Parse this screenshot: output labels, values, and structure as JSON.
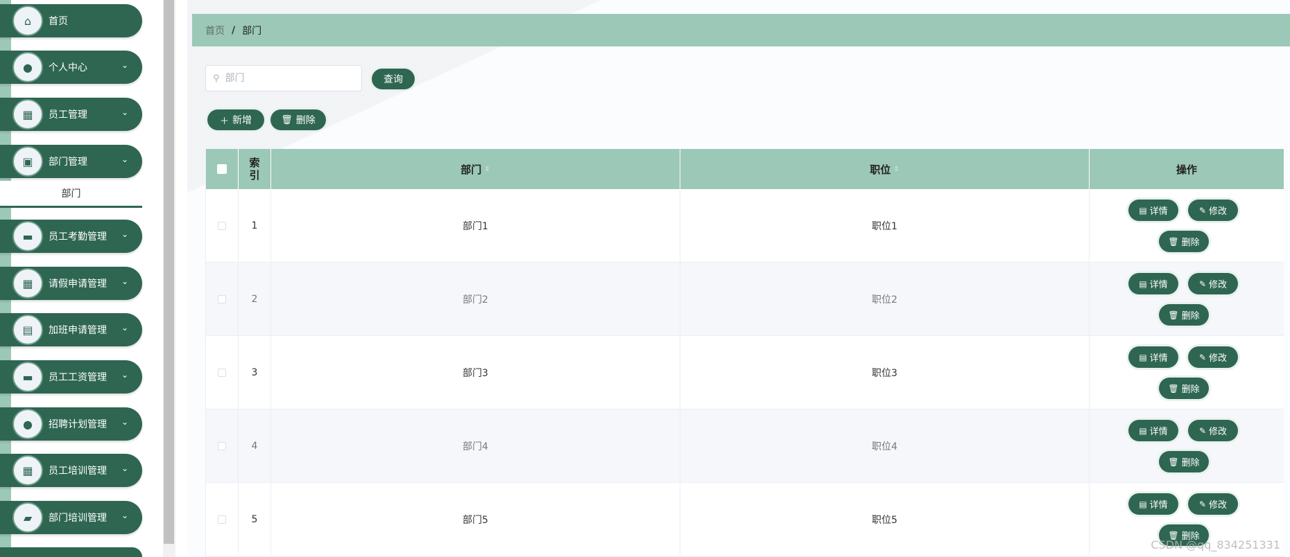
{
  "sidebar": {
    "items": [
      {
        "label": "首页",
        "icon": "home-icon",
        "glyph": "⌂",
        "has_chevron": false
      },
      {
        "label": "个人中心",
        "icon": "user-icon",
        "glyph": "●",
        "has_chevron": true
      },
      {
        "label": "员工管理",
        "icon": "grid-icon",
        "glyph": "▦",
        "has_chevron": true
      },
      {
        "label": "部门管理",
        "icon": "clipboard-icon",
        "glyph": "▣",
        "has_chevron": true
      },
      {
        "label": "员工考勤管理",
        "icon": "message-icon",
        "glyph": "▬",
        "has_chevron": true
      },
      {
        "label": "请假申请管理",
        "icon": "grid-icon",
        "glyph": "▦",
        "has_chevron": true
      },
      {
        "label": "加班申请管理",
        "icon": "briefcase-icon",
        "glyph": "▤",
        "has_chevron": true
      },
      {
        "label": "员工工资管理",
        "icon": "card-icon",
        "glyph": "▬",
        "has_chevron": true
      },
      {
        "label": "招聘计划管理",
        "icon": "user-icon",
        "glyph": "●",
        "has_chevron": true
      },
      {
        "label": "员工培训管理",
        "icon": "grid-icon",
        "glyph": "▦",
        "has_chevron": true
      },
      {
        "label": "部门培训管理",
        "icon": "wallet-icon",
        "glyph": "▰",
        "has_chevron": true
      }
    ],
    "submenu_label": "部门",
    "chevron": "⌄"
  },
  "breadcrumb": {
    "home": "首页",
    "sep": "/",
    "current": "部门"
  },
  "search": {
    "placeholder": "部门",
    "query_label": "查询"
  },
  "toolbar": {
    "add_label": "新增",
    "delete_label": "删除"
  },
  "table": {
    "headers": {
      "index": "索\n引",
      "dept": "部门",
      "position": "职位",
      "actions": "操作"
    },
    "rows": [
      {
        "index": "1",
        "dept": "部门1",
        "position": "职位1"
      },
      {
        "index": "2",
        "dept": "部门2",
        "position": "职位2"
      },
      {
        "index": "3",
        "dept": "部门3",
        "position": "职位3"
      },
      {
        "index": "4",
        "dept": "部门4",
        "position": "职位4"
      },
      {
        "index": "5",
        "dept": "部门5",
        "position": "职位5"
      }
    ],
    "actions": {
      "detail": "详情",
      "edit": "修改",
      "delete": "删除"
    }
  },
  "watermark": "CSDN @qq_834251331",
  "colors": {
    "primary": "#2e6652",
    "header": "#9cc8b7"
  }
}
